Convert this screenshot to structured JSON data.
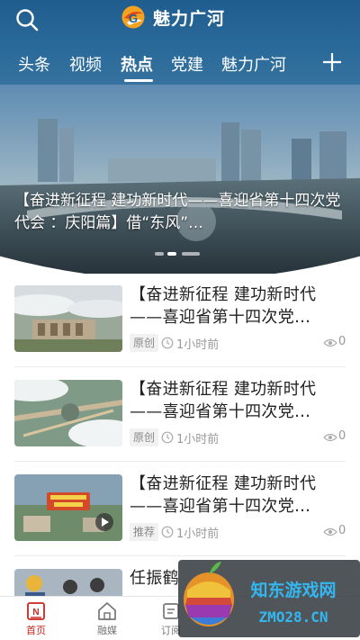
{
  "header": {
    "app_title": "魅力广河",
    "tabs": [
      "头条",
      "视频",
      "热点",
      "党建",
      "魅力广河"
    ],
    "active_tab": "热点"
  },
  "banner": {
    "caption": "【奋进新征程 建功新时代——喜迎省第十四次党代会 ：庆阳篇】借“东风”…"
  },
  "news": [
    {
      "title": "【奋进新征程 建功新时代——喜迎省第十四次党…",
      "tag": "原创",
      "time": "1小时前",
      "views": "0"
    },
    {
      "title": "【奋进新征程 建功新时代——喜迎省第十四次党…",
      "tag": "原创",
      "time": "1小时前",
      "views": "0"
    },
    {
      "title": "【奋进新征程 建功新时代——喜迎省第十四次党…",
      "tag": "推荐",
      "time": "1小时前",
      "views": "0"
    },
    {
      "title": "任振鹤"
    }
  ],
  "bottom_nav": [
    {
      "label": "首页",
      "icon": "home-news-icon",
      "active": true
    },
    {
      "label": "融媒",
      "icon": "house-icon"
    },
    {
      "label": "订阅",
      "icon": "subscribe-icon"
    }
  ],
  "watermark": {
    "line1": "知东游戏网",
    "line2": "ZMO28.CN"
  },
  "colors": {
    "header_bg": "#2a6a9a",
    "accent_red": "#c8261e",
    "text": "#222222",
    "meta": "#999999"
  }
}
